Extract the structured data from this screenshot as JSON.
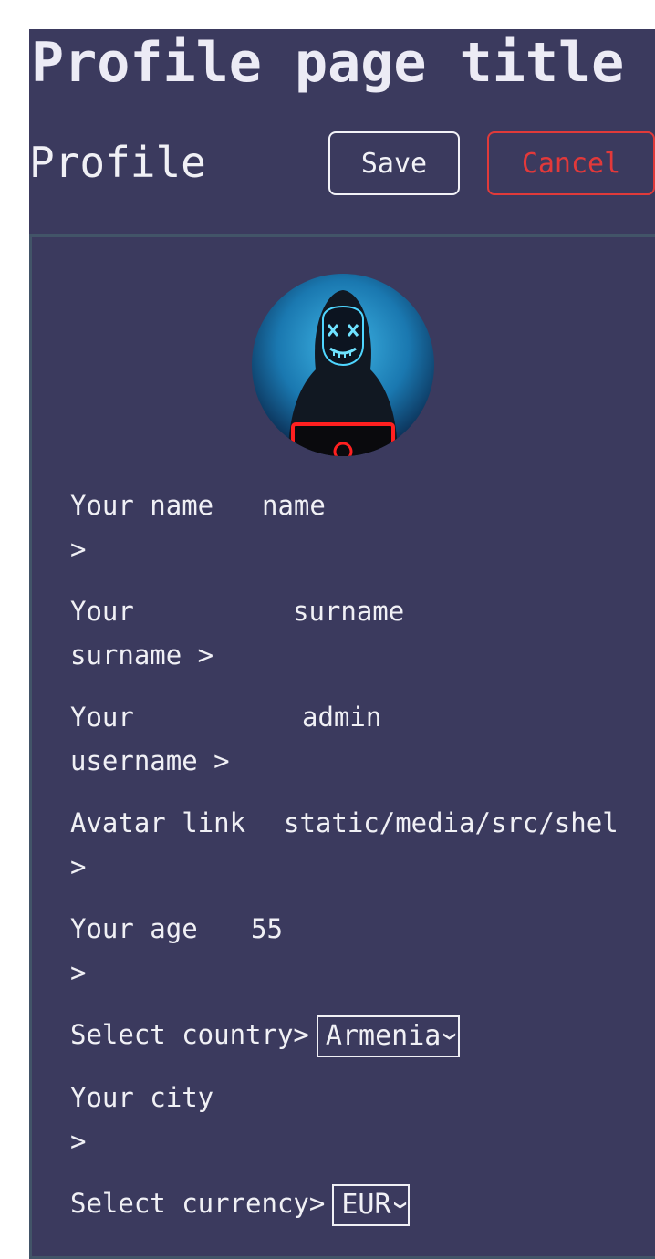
{
  "page": {
    "title": "Profile page title"
  },
  "header": {
    "label": "Profile",
    "save_label": "Save",
    "cancel_label": "Cancel"
  },
  "form": {
    "name": {
      "label": "Your name",
      "value": "name",
      "arrow": ">"
    },
    "surname": {
      "label1": "Your",
      "label2": "surname >",
      "value": "surname"
    },
    "username": {
      "label1": "Your",
      "label2": "username >",
      "value": "admin"
    },
    "avatar_link": {
      "label": "Avatar link",
      "value": "static/media/src/shell.jpg",
      "arrow": ">"
    },
    "age": {
      "label": "Your age",
      "value": "55",
      "arrow": ">"
    },
    "country": {
      "label": "Select country>",
      "selected": "Armenia"
    },
    "city": {
      "label": "Your city",
      "value": "",
      "arrow": ">"
    },
    "currency": {
      "label": "Select currency>",
      "selected": "EUR"
    }
  },
  "colors": {
    "background": "#3b3a5e",
    "cancel_accent": "#e2393a",
    "card_border": "#425468"
  },
  "icons": {
    "avatar": "hooded-figure-avatar",
    "select_chevron": "chevron-down-icon"
  }
}
